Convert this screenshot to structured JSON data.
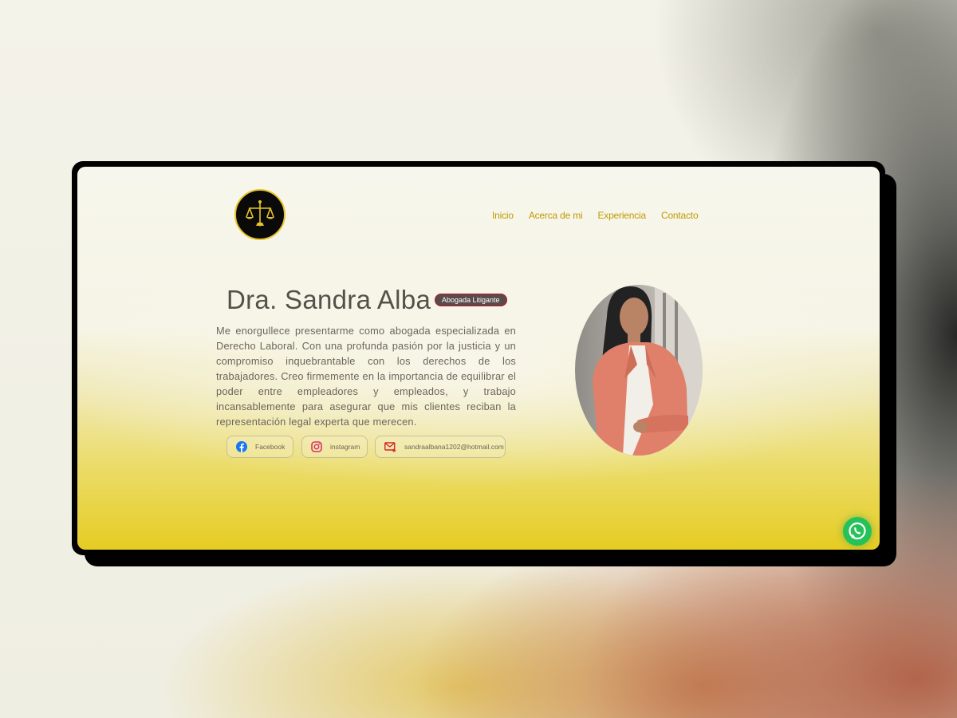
{
  "header": {
    "logo_icon": "scales-of-justice-icon",
    "nav": [
      {
        "label": "Inicio"
      },
      {
        "label": "Acerca de mi"
      },
      {
        "label": "Experiencia"
      },
      {
        "label": "Contacto"
      }
    ]
  },
  "hero": {
    "title": "Dra. Sandra Alba",
    "badge": "Abogada Litigante",
    "bio": "Me enorgullece presentarme como abogada especializada en Derecho Laboral. Con una profunda pasión por la justicia y un compromiso inquebrantable con los derechos de los trabajadores. Creo firmemente en la importancia de equilibrar el poder entre empleadores y empleados, y trabajo incansablemente para asegurar que mis clientes reciban la representación legal experta que merecen."
  },
  "social": {
    "facebook": {
      "label": "Facebook",
      "icon": "facebook-icon"
    },
    "instagram": {
      "label": "instagram",
      "icon": "instagram-icon"
    },
    "email": {
      "label": "sandraalbana1202@hotmail.com",
      "icon": "mail-icon"
    }
  },
  "floating": {
    "whatsapp_icon": "whatsapp-icon"
  },
  "colors": {
    "accent": "#c09a00",
    "badge_border": "#b8102c",
    "whatsapp": "#25c25a"
  }
}
